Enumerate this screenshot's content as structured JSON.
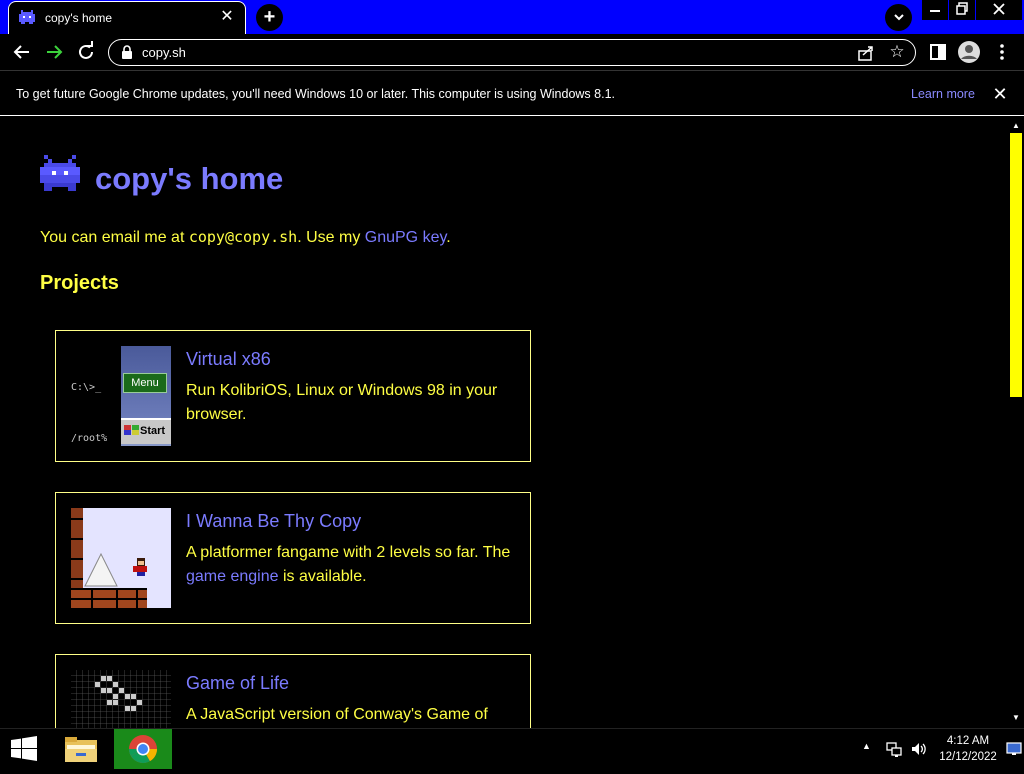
{
  "browser": {
    "tab_title": "copy's home",
    "url": "copy.sh",
    "infobar_message": "To get future Google Chrome updates, you'll need Windows 10 or later. This computer is using Windows 8.1.",
    "infobar_link": "Learn more"
  },
  "page": {
    "title": "copy's home",
    "email_prefix": "You can email me at ",
    "email_address": "copy@copy.sh",
    "email_middle": ". Use my ",
    "gnupg_link": "GnuPG key",
    "email_suffix": ".",
    "projects_heading": "Projects",
    "projects": [
      {
        "title": "Virtual x86",
        "description": "Run KolibriOS, Linux or Windows 98 in your browser.",
        "thumb_prompt1": "C:\\>_",
        "thumb_prompt2": "/root%",
        "thumb_menu": "Menu",
        "thumb_start": "Start"
      },
      {
        "title": "I Wanna Be Thy Copy",
        "description_prefix": "A platformer fangame with 2 levels so far. The ",
        "description_link": "game engine",
        "description_suffix": " is available."
      },
      {
        "title": "Game of Life",
        "description": "A JavaScript version of Conway's Game of"
      }
    ]
  },
  "taskbar": {
    "time": "4:12 AM",
    "date": "12/12/2022"
  },
  "colors": {
    "title_bar": "#0000ff",
    "link": "#7b7bff",
    "text": "#ffff44",
    "scroll_thumb": "#ffff00",
    "chrome_task": "#1a8a1a"
  }
}
